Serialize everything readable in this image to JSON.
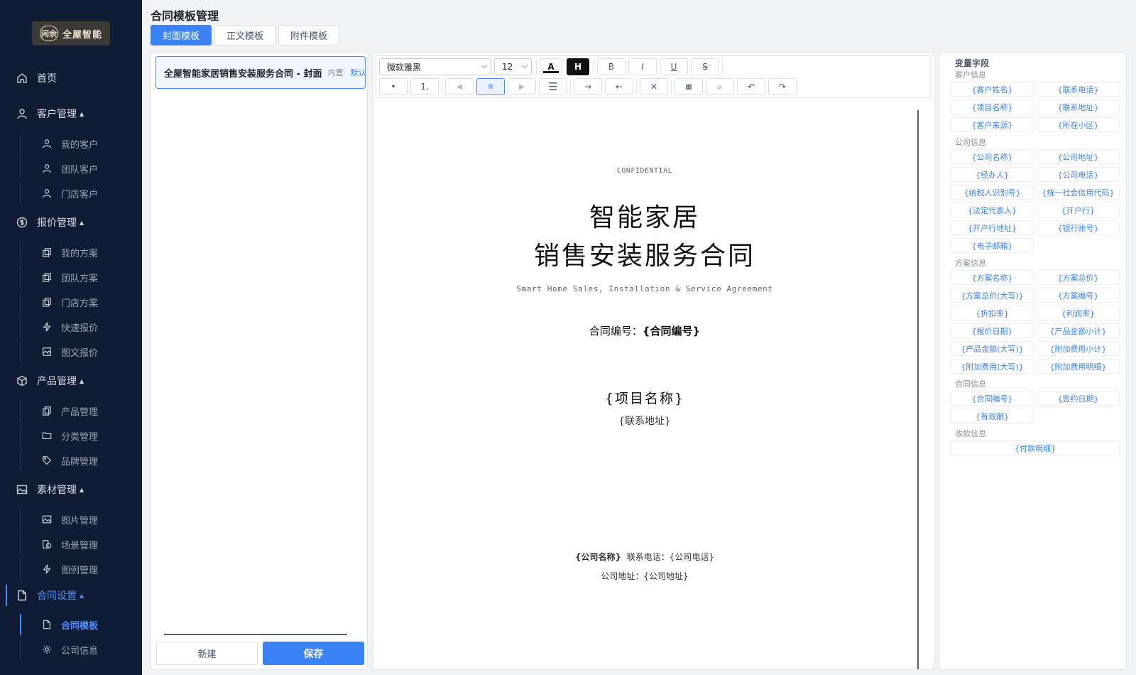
{
  "brand": {
    "logo_mark": "闲余",
    "logo_text": "全屋智能"
  },
  "sidebar": {
    "home": "首页",
    "customer": {
      "label": "客户管理",
      "items": [
        "我的客户",
        "团队客户",
        "门店客户"
      ]
    },
    "quote": {
      "label": "报价管理",
      "items": [
        "我的方案",
        "团队方案",
        "门店方案",
        "快速报价",
        "图文报价"
      ]
    },
    "product": {
      "label": "产品管理",
      "items": [
        "产品管理",
        "分类管理",
        "品牌管理"
      ]
    },
    "material": {
      "label": "素材管理",
      "items": [
        "图片管理",
        "场景管理",
        "图例管理"
      ]
    },
    "contract": {
      "label": "合同设置",
      "items": [
        "合同模板",
        "公司信息"
      ]
    }
  },
  "page": {
    "title": "合同模板管理"
  },
  "tabs": [
    "封面模板",
    "正文模板",
    "附件模板"
  ],
  "template_list": {
    "item_name": "全屋智能家居销售安装服务合同 - 封面",
    "item_badge": "内置",
    "item_default": "默认",
    "new_label": "新建",
    "save_label": "保存"
  },
  "toolbar": {
    "font_family": "微软雅黑",
    "font_size": "12",
    "color_label": "A",
    "highlight_label": "H",
    "bold": "B",
    "italic": "I",
    "underline": "U",
    "strike": "S",
    "bullet": "•",
    "numbered": "1.",
    "align_left": "◀",
    "align_center": "Ⅲ",
    "align_right": "▶",
    "justify": "☰",
    "indent": "→",
    "outdent": "←",
    "clear": "✕",
    "table": "▦",
    "find": "⌕",
    "undo": "↶",
    "redo": "↷"
  },
  "document": {
    "confidential": "CONFIDENTIAL",
    "title_line1": "智能家居",
    "title_line2": "销售安装服务合同",
    "subtitle_en": "Smart Home Sales, Installation & Service Agreement",
    "contract_no_label": "合同编号：",
    "contract_no_value": "{合同编号}",
    "project_name": "{项目名称}",
    "contact_address": "{联系地址}",
    "company_name": "{公司名称}",
    "company_phone": "联系电话：{公司电话}",
    "company_address": "公司地址：{公司地址}"
  },
  "variables": {
    "title": "变量字段",
    "groups": [
      {
        "name": "客户信息",
        "fields": [
          "{客户姓名}",
          "{联系电话}",
          "{项目名称}",
          "{联系地址}",
          "{客户来源}",
          "{所在小区}"
        ]
      },
      {
        "name": "公司信息",
        "fields": [
          "{公司名称}",
          "{公司地址}",
          "{经办人}",
          "{公司电话}",
          "{纳税人识别号}",
          "{统一社会信用代码}",
          "{法定代表人}",
          "{开户行}",
          "{开户行地址}",
          "{银行账号}",
          "{电子邮箱}"
        ]
      },
      {
        "name": "方案信息",
        "fields": [
          "{方案名称}",
          "{方案总价}",
          "{方案总价(大写)}",
          "{方案编号}",
          "{折扣率}",
          "{利润率}",
          "{报价日期}",
          "{产品金额小计}",
          "{产品金额(大写)}",
          "{附加费用小计}",
          "{附加费用(大写)}",
          "{附加费用明细}"
        ]
      },
      {
        "name": "合同信息",
        "fields": [
          "{合同编号}",
          "{签约日期}",
          "{有效期}"
        ]
      },
      {
        "name": "收款信息",
        "fields": [
          "{付款明细}"
        ]
      }
    ]
  },
  "colors": {
    "sidebar_bg": "#0f1c33",
    "accent": "#3b82f6",
    "page_bg": "#f2f3f5"
  }
}
